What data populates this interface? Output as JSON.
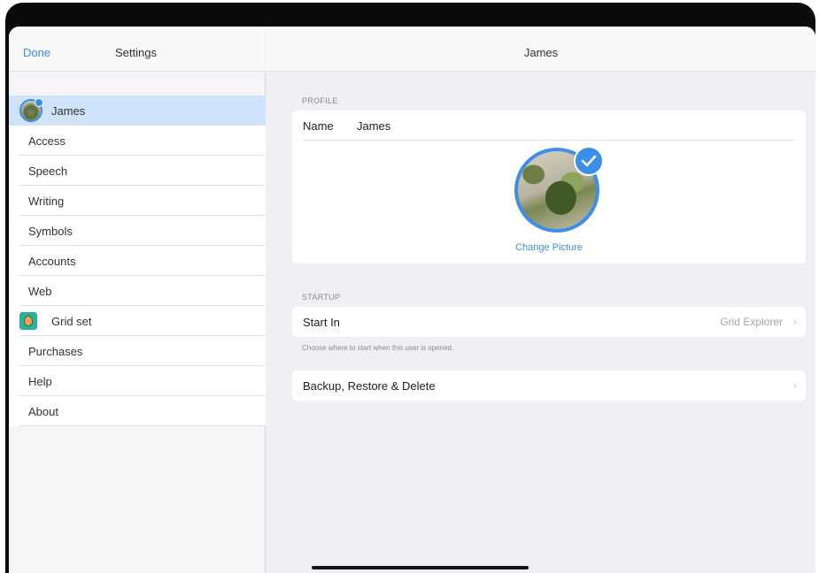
{
  "sidebar": {
    "done_label": "Done",
    "title": "Settings",
    "items": [
      {
        "label": "James",
        "icon": "user-avatar-icon",
        "selected": true
      },
      {
        "label": "Access"
      },
      {
        "label": "Speech"
      },
      {
        "label": "Writing"
      },
      {
        "label": "Symbols"
      },
      {
        "label": "Accounts"
      },
      {
        "label": "Web"
      },
      {
        "label": "Grid set",
        "icon": "grid-set-icon"
      },
      {
        "label": "Purchases"
      },
      {
        "label": "Help"
      },
      {
        "label": "About"
      }
    ]
  },
  "detail": {
    "title": "James",
    "profile": {
      "section_label": "PROFILE",
      "name_label": "Name",
      "name_value": "James",
      "change_picture_label": "Change Picture"
    },
    "startup": {
      "section_label": "STARTUP",
      "start_in_label": "Start In",
      "start_in_value": "Grid Explorer",
      "helper_text": "Choose where to start when this user is opened."
    },
    "backup_label": "Backup, Restore & Delete"
  },
  "colors": {
    "accent": "#3d8ee8",
    "selected_row": "#cfe4fb",
    "background": "#efeff4"
  }
}
